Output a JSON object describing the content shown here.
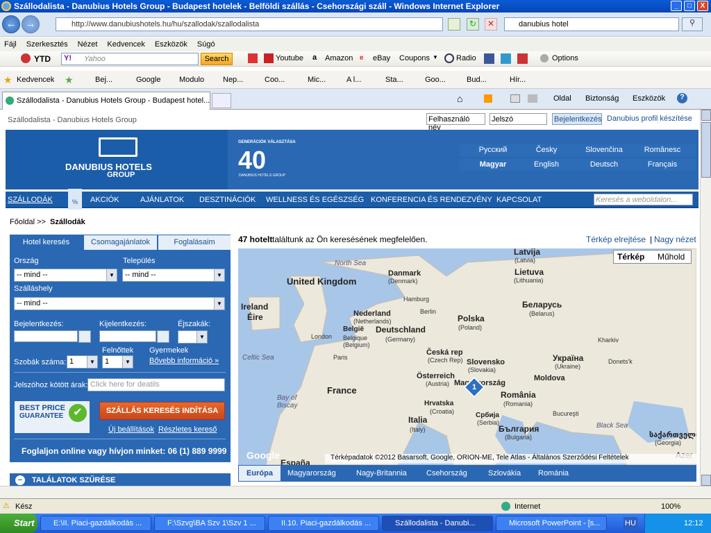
{
  "window": {
    "title": "Szállodalista - Danubius Hotels Group - Budapest hotelek - Belföldi szállás - Csehországi száll - Windows Internet Explorer",
    "min": "_",
    "max": "□",
    "close": "X"
  },
  "address": {
    "url": "http://www.danubiushotels.hu/hu/szallodak/szallodalista",
    "search_value": "danubius hotel"
  },
  "menu": [
    "Fájl",
    "Szerkesztés",
    "Nézet",
    "Kedvencek",
    "Eszközök",
    "Súgó"
  ],
  "toolbar": {
    "ytd": "YTD",
    "yahoo_placeholder": "Yahoo",
    "search_btn": "Search",
    "items": [
      "Youtube",
      "Amazon",
      "eBay",
      "Coupons",
      "Radio"
    ],
    "options": "Options"
  },
  "favorites": {
    "label": "Kedvencek",
    "items": [
      "Bej...",
      "Google",
      "Modulo",
      "Nep...",
      "Coo...",
      "Mic...",
      "A l...",
      "Sta...",
      "Goo...",
      "Bud...",
      "Hír..."
    ]
  },
  "tab": {
    "title": "Szállodalista - Danubius Hotels Group - Budapest hotel...",
    "right": [
      "Oldal",
      "Biztonság",
      "Eszközök"
    ]
  },
  "site": {
    "breadcrumb_top": "Szállodalista - Danubius Hotels Group",
    "user_placeholder": "Felhasználó név",
    "pass_placeholder": "Jelszó",
    "login_btn": "Bejelentkezés",
    "profile_link": "Danubius profil készítése",
    "logo_line1": "DANUBIUS HOTELS",
    "logo_line2": "GROUP",
    "badge_top": "GENERÁCIÓK VÁLASZTÁSA",
    "badge_num": "40",
    "badge_bottom": "DANUBIUS HOTELS GROUP",
    "languages": [
      "Русский",
      "Česky",
      "Slovenčina",
      "Românesc",
      "Magyar",
      "English",
      "Deutsch",
      "Français"
    ],
    "nav": [
      "SZÁLLODÁK",
      "AKCIÓK",
      "AJÁNLATOK",
      "DESZTINÁCIÓK",
      "WELLNESS ÉS EGÉSZSÉG",
      "KONFERENCIA ÉS RENDEZVÉNY",
      "KAPCSOLAT"
    ],
    "site_search_placeholder": "Keresés a weboldalon...",
    "crumb_home": "Főoldal >>",
    "crumb_current": "Szállodák",
    "tabs": [
      "Hotel keresés",
      "Csomagajánlatok",
      "Foglalásaim"
    ],
    "country_label": "Ország",
    "city_label": "Település",
    "lodging_label": "Szálláshely",
    "select_default": "-- mind --",
    "checkin_label": "Bejelentkezés:",
    "checkout_label": "Kijelentkezés:",
    "nights_label": "Éjszakák:",
    "rooms_label": "Szobák száma:",
    "rooms_value": "1",
    "adults_label": "Felnőttek",
    "adults_value": "1",
    "children_label": "Gyermekek",
    "more_info": "Bővebb információ »",
    "promo_label": "Jelszóhoz kötött árak:",
    "promo_placeholder": "Click here for deatils",
    "best_price_1": "BEST PRICE",
    "best_price_2": "GUARANTEE",
    "search_btn": "SZÁLLÁS KERESÉS INDÍTÁSA",
    "new_settings": "Új beállítások",
    "detailed_search": "Részletes kereső",
    "phone": "Foglaljon online vagy hívjon minket: 06 (1) 889 9999",
    "filter": "TALÁLATOK SZŰRÉSE",
    "result_count": "47 hotelt",
    "result_text": " találtunk az Ön keresésének megfelelően.",
    "hide_map": "Térkép elrejtése",
    "sep": "|",
    "large_view": "Nagy nézet",
    "map_type": [
      "Térkép",
      "Műhold"
    ],
    "map_copyright": "Térképadatok ©2012 Basarsoft, Google, ORION-ME, Tele Atlas - Általános Szerződési Feltételek",
    "google": "Google",
    "marker": "1",
    "region_tabs": [
      "Európa",
      "Magyarország",
      "Nagy-Britannia",
      "Csehország",
      "Szlovákia",
      "Románia"
    ]
  },
  "map_labels": [
    {
      "t": "Latvija",
      "s": "(Latvia)"
    },
    {
      "t": "Lietuva",
      "s": "(Lithuania)"
    },
    {
      "t": "Danmark",
      "s": "(Denmark)"
    },
    {
      "t": "United Kingdom",
      "s": ""
    },
    {
      "t": "Ireland",
      "s": "Éire"
    },
    {
      "t": "Беларусь",
      "s": "(Belarus)"
    },
    {
      "t": "Nederland",
      "s": "(Netherlands)"
    },
    {
      "t": "Polska",
      "s": "(Poland)"
    },
    {
      "t": "Deutschland",
      "s": "(Germany)"
    },
    {
      "t": "België",
      "s": "Belgique (Belgium)"
    },
    {
      "t": "Česká rep",
      "s": "(Czech Rep)"
    },
    {
      "t": "Slovensko",
      "s": "(Slovakia)"
    },
    {
      "t": "Україна",
      "s": "(Ukraine)"
    },
    {
      "t": "Moldova",
      "s": ""
    },
    {
      "t": "Österreich",
      "s": "(Austria)"
    },
    {
      "t": "Magyarország",
      "s": ""
    },
    {
      "t": "France",
      "s": ""
    },
    {
      "t": "România",
      "s": "(Romania)"
    },
    {
      "t": "Hrvatska",
      "s": "(Croatia)"
    },
    {
      "t": "Србија",
      "s": "(Serbia)"
    },
    {
      "t": "Italia",
      "s": "(Italy)"
    },
    {
      "t": "България",
      "s": "(Bulgaria)"
    },
    {
      "t": "España",
      "s": ""
    },
    {
      "t": "საქართველო",
      "s": "(Georgia)"
    }
  ],
  "map_cities": [
    "Hamburg",
    "Berlin",
    "London",
    "Paris",
    "Bucureşti",
    "Kharkiv",
    "Donets'k",
    "Azer"
  ],
  "map_seas": [
    "North Sea",
    "Celtic Sea",
    "Bay of Biscay",
    "Black Sea"
  ],
  "status": {
    "text": "Kész",
    "zone": "Internet",
    "zoom": "100%"
  },
  "taskbar": {
    "start": "Start",
    "items": [
      "E:\\II. Piaci-gazdálkodás ...",
      "F:\\Szvg\\BA Szv 1\\Szv 1 ...",
      "II.10. Piaci-gazdálkodás ...",
      "Szállodalista - Danubi...",
      "Microsoft PowerPoint - [s..."
    ],
    "lang": "HU",
    "clock": "12:12"
  }
}
